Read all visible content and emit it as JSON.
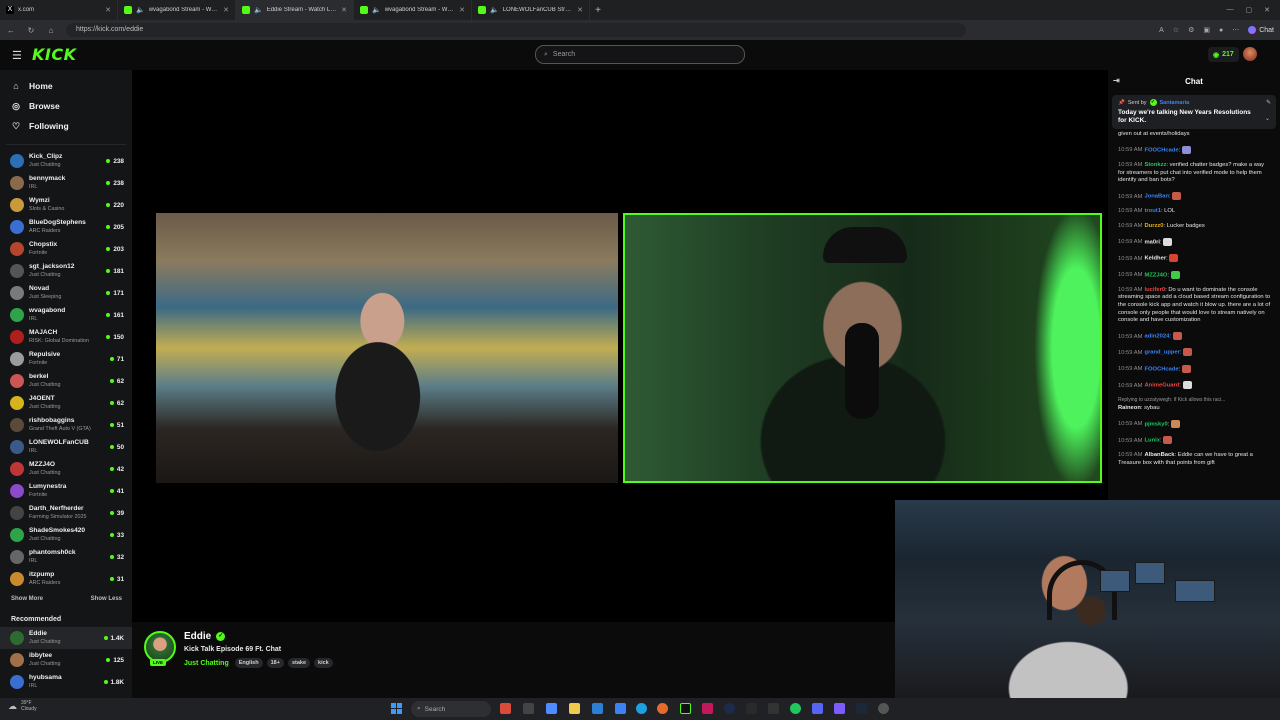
{
  "browser": {
    "tabs": [
      {
        "title": "x.com",
        "icon": "x-logo-icon",
        "active": false
      },
      {
        "title": "wvagabond Stream - Watch Live",
        "icon": "kick-icon",
        "active": false
      },
      {
        "title": "Eddie Stream - Watch Live on",
        "icon": "kick-icon",
        "active": true
      },
      {
        "title": "wvagabond Stream - Watch Live",
        "icon": "kick-icon",
        "active": false
      },
      {
        "title": "LONEWOLFanCUB Stream - Watch",
        "icon": "kick-icon",
        "active": false
      }
    ],
    "url": "https://kick.com/eddie",
    "chat_button": "Chat"
  },
  "header": {
    "logo": "KICK",
    "search_placeholder": "Search",
    "points": "217"
  },
  "sidebar": {
    "nav": [
      {
        "label": "Home",
        "icon": "home-icon"
      },
      {
        "label": "Browse",
        "icon": "compass-icon"
      },
      {
        "label": "Following",
        "icon": "heart-icon"
      }
    ],
    "following": [
      {
        "name": "Kick_Clipz",
        "category": "Just Chatting",
        "viewers": "238",
        "color": "#2c6fb5"
      },
      {
        "name": "bennymack",
        "category": "IRL",
        "viewers": "238",
        "color": "#8a6a4a"
      },
      {
        "name": "Wymzi",
        "category": "Slots & Casino",
        "viewers": "220",
        "color": "#c99a3b"
      },
      {
        "name": "BlueDogStephens",
        "category": "ARC Raiders",
        "viewers": "205",
        "color": "#3a6fd1"
      },
      {
        "name": "Chopstix",
        "category": "Fortnite",
        "viewers": "203",
        "color": "#b5452c"
      },
      {
        "name": "sgt_jackson12",
        "category": "Just Chatting",
        "viewers": "181",
        "color": "#555"
      },
      {
        "name": "Novad",
        "category": "Just Sleeping",
        "viewers": "171",
        "color": "#7a7a7a"
      },
      {
        "name": "wvagabond",
        "category": "IRL",
        "viewers": "161",
        "color": "#2fa34a"
      },
      {
        "name": "MAJACH",
        "category": "RISK: Global Domination",
        "viewers": "150",
        "color": "#b01e1e"
      },
      {
        "name": "Repulsive",
        "category": "Fortnite",
        "viewers": "71",
        "color": "#9c9c9c"
      },
      {
        "name": "berkel",
        "category": "Just Chatting",
        "viewers": "62",
        "color": "#c55"
      },
      {
        "name": "J4OENT",
        "category": "Just Chatting",
        "viewers": "62",
        "color": "#d4b31c"
      },
      {
        "name": "rishbobaggins",
        "category": "Grand Theft Auto V (GTA)",
        "viewers": "51",
        "color": "#5a4a3a"
      },
      {
        "name": "LONEWOLFanCUB",
        "category": "IRL",
        "viewers": "50",
        "color": "#3b5a8a"
      },
      {
        "name": "MZZJ4O",
        "category": "Just Chatting",
        "viewers": "42",
        "color": "#c03535"
      },
      {
        "name": "Lumynestra",
        "category": "Fortnite",
        "viewers": "41",
        "color": "#8a4ac9"
      },
      {
        "name": "Darth_Nerfherder",
        "category": "Farming Simulator 2025",
        "viewers": "39",
        "color": "#444"
      },
      {
        "name": "ShadeSmokes420",
        "category": "Just Chatting",
        "viewers": "33",
        "color": "#2fa34a"
      },
      {
        "name": "phantomsh0ck",
        "category": "IRL",
        "viewers": "32",
        "color": "#666"
      },
      {
        "name": "itzpump",
        "category": "ARC Raiders",
        "viewers": "31",
        "color": "#c98a2f"
      }
    ],
    "show_more": "Show More",
    "show_less": "Show Less",
    "recommended_title": "Recommended",
    "recommended": [
      {
        "name": "Eddie",
        "category": "Just Chatting",
        "viewers": "1.4K",
        "color": "#2d6b30"
      },
      {
        "name": "ibbytee",
        "category": "Just Chatting",
        "viewers": "125",
        "color": "#a0704a"
      },
      {
        "name": "hyubsama",
        "category": "IRL",
        "viewers": "1.8K",
        "color": "#3a6fd1"
      }
    ]
  },
  "channel": {
    "name": "Eddie",
    "live_badge": "LIVE",
    "title": "Kick Talk Episode 69 Ft. Chat",
    "category": "Just Chatting",
    "tags": [
      "English",
      "18+",
      "stake",
      "kick"
    ]
  },
  "chat": {
    "title": "Chat",
    "pinned": {
      "sent_by_label": "Sent by",
      "sender": "Santamaria",
      "message": "Today we're talking New Years Resolutions for KICK."
    },
    "messages": [
      {
        "time": "",
        "user": "",
        "user_color": "#e6e6e6",
        "text": "given out at events/holidays",
        "emote": ""
      },
      {
        "time": "10:59 AM",
        "user": "FOOCHcade",
        "user_color": "#3b82f6",
        "text": "",
        "emote": "#8f8fd8"
      },
      {
        "time": "10:59 AM",
        "user": "Stonkzz",
        "user_color": "#22c55e",
        "text": "verified chatter badges? make a way for streamers to put chat into verified mode to help them identify and ban bots?",
        "emote": ""
      },
      {
        "time": "10:59 AM",
        "user": "JonaBan",
        "user_color": "#3b82f6",
        "text": "",
        "emote": "#c65a4a"
      },
      {
        "time": "10:59 AM",
        "user": "trout1",
        "user_color": "#3b82f6",
        "text": "LOL",
        "emote": ""
      },
      {
        "time": "10:59 AM",
        "user": "Durzz0",
        "user_color": "#eab308",
        "text": "Lucker badges",
        "emote": ""
      },
      {
        "time": "10:59 AM",
        "user": "ma0ri",
        "user_color": "#e6e6e6",
        "text": "",
        "emote": "#dddddd"
      },
      {
        "time": "10:59 AM",
        "user": "Keldher",
        "user_color": "#e6e6e6",
        "text": "",
        "emote": "#d9432f"
      },
      {
        "time": "10:59 AM",
        "user": "MZZJ4O",
        "user_color": "#22c55e",
        "text": "",
        "emote": "#44c84a"
      },
      {
        "time": "10:59 AM",
        "user": "lucifer0",
        "user_color": "#ef4444",
        "text": "Do u want to dominate the console streaming space add a cloud based stream configuration to the console kick app and watch it blow up. there are a lot of console only people that would love to stream natively on console and have customization",
        "emote": ""
      },
      {
        "time": "10:59 AM",
        "user": "adin2024",
        "user_color": "#3b82f6",
        "text": "",
        "emote": "#c65a4a"
      },
      {
        "time": "10:59 AM",
        "user": "grand_upper",
        "user_color": "#3b82f6",
        "text": "",
        "emote": "#c65a4a"
      },
      {
        "time": "10:59 AM",
        "user": "FOOCHcade",
        "user_color": "#3b82f6",
        "text": "",
        "emote": "#c65a4a"
      },
      {
        "time": "10:59 AM",
        "user": "AnimeGuard",
        "user_color": "#ef4444",
        "text": "",
        "emote": "#dddddd"
      },
      {
        "time": "",
        "user": "Raineon",
        "user_color": "#e6e6e6",
        "text": "sybau",
        "emote": "",
        "reply": "Replying to uzzatywegh: If Kick allows this raci..."
      },
      {
        "time": "10:59 AM",
        "user": "pjmsky0",
        "user_color": "#22c55e",
        "text": "",
        "emote": "#c98a5a"
      },
      {
        "time": "10:59 AM",
        "user": "Lunix",
        "user_color": "#22c55e",
        "text": "",
        "emote": "#c65a4a"
      },
      {
        "time": "10:59 AM",
        "user": "AlbanBack",
        "user_color": "#e6e6e6",
        "text": "Eddie can we have to great a Treasure box with that points from gift",
        "emote": ""
      }
    ]
  },
  "taskbar": {
    "weather_temp": "39°F",
    "weather_desc": "Cloudy",
    "search_placeholder": "Search"
  },
  "colors": {
    "accent": "#53fc18",
    "background": "#0b0b0c",
    "sidebar": "#141517"
  }
}
